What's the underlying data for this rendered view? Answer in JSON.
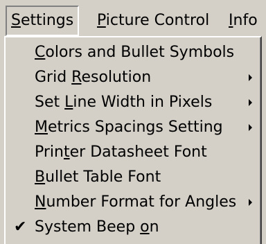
{
  "menubar": {
    "items": [
      {
        "label_pre": "",
        "mnemonic": "S",
        "label_post": "ettings"
      },
      {
        "label_pre": "",
        "mnemonic": "P",
        "label_post": "icture Control"
      },
      {
        "label_pre": "",
        "mnemonic": "I",
        "label_post": "nfo"
      }
    ]
  },
  "settings_menu": {
    "items": [
      {
        "pre": "",
        "mn": "C",
        "post": "olors and Bullet Symbols",
        "submenu": false,
        "checked": false
      },
      {
        "pre": "Grid ",
        "mn": "R",
        "post": "esolution",
        "submenu": true,
        "checked": false
      },
      {
        "pre": "Set ",
        "mn": "L",
        "post": "ine Width in Pixels",
        "submenu": true,
        "checked": false
      },
      {
        "pre": "",
        "mn": "M",
        "post": "etrics Spacings Setting",
        "submenu": true,
        "checked": false
      },
      {
        "pre": "Prin",
        "mn": "t",
        "post": "er Datasheet Font",
        "submenu": false,
        "checked": false
      },
      {
        "pre": "",
        "mn": "B",
        "post": "ullet Table Font",
        "submenu": false,
        "checked": false
      },
      {
        "pre": "",
        "mn": "N",
        "post": "umber Format for Angles",
        "submenu": true,
        "checked": false
      },
      {
        "pre": "System Beep ",
        "mn": "o",
        "post": "n",
        "submenu": false,
        "checked": true
      }
    ],
    "check_glyph": "✔"
  },
  "colors": {
    "face": "#d4d0c8",
    "highlight": "#ffffff",
    "shadow": "#808080",
    "dark_shadow": "#404040"
  }
}
